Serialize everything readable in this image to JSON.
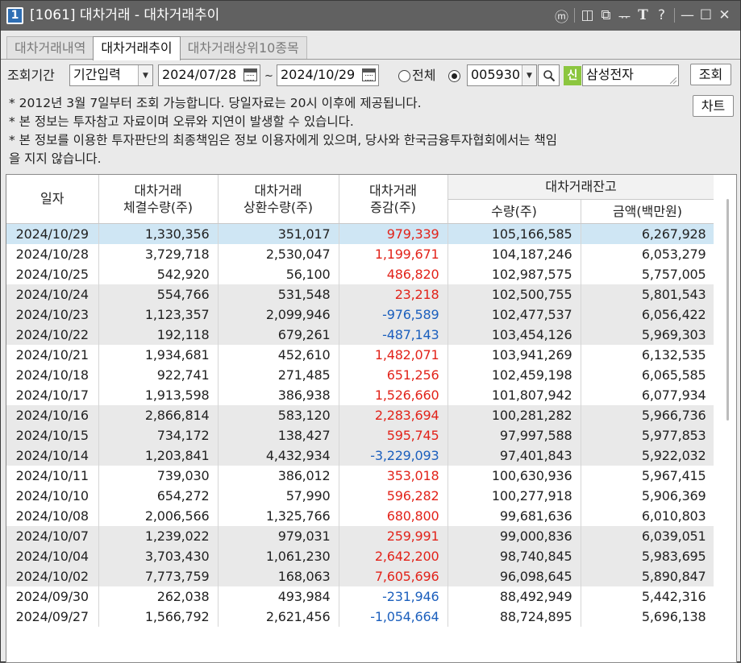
{
  "window": {
    "number": "1",
    "title": "[1061] 대차거래 - 대차거래추이"
  },
  "title_icons": [
    "memo-icon",
    "restore-icon",
    "copy-window-icon",
    "pin-icon",
    "font-icon",
    "help-icon",
    "minimize-icon",
    "maximize-icon",
    "close-icon"
  ],
  "title_icon_glyphs": [
    "ⓜ",
    "◫",
    "⧉",
    "ᅲ",
    "T",
    "?",
    "—",
    "☐",
    "✕"
  ],
  "tabs": [
    {
      "label": "대차거래내역",
      "active": false
    },
    {
      "label": "대차거래추이",
      "active": true
    },
    {
      "label": "대차거래상위10종목",
      "active": false
    }
  ],
  "query": {
    "period_label": "조회기간",
    "period_mode": "기간입력",
    "start_date": "2024/07/28",
    "tilde": "~",
    "end_date": "2024/10/29",
    "all_label": "전체",
    "stock_code": "005930",
    "badge": "신",
    "stock_name": "삼성전자",
    "search_button": "조회",
    "chart_button": "차트"
  },
  "notices": [
    "* 2012년 3월 7일부터 조회 가능합니다. 당일자료는 20시 이후에 제공됩니다.",
    "* 본 정보는 투자참고 자료이며 오류와 지연이 발생할 수 있습니다.",
    "* 본 정보를 이용한 투자판단의 최종책임은 정보 이용자에게 있으며, 당사와 한국금융투자협회에서는 책임",
    "   을 지지 않습니다."
  ],
  "table": {
    "headers": {
      "date": "일자",
      "executed": "대차거래\n체결수량(주)",
      "repaid": "대차거래\n상환수량(주)",
      "change": "대차거래\n증감(주)",
      "balance_group": "대차거래잔고",
      "balance_qty": "수량(주)",
      "balance_amt": "금액(백만원)"
    },
    "rows": [
      {
        "date": "2024/10/29",
        "executed": "1,330,356",
        "repaid": "351,017",
        "change": "979,339",
        "qty": "105,166,585",
        "amt": "6,267,928"
      },
      {
        "date": "2024/10/28",
        "executed": "3,729,718",
        "repaid": "2,530,047",
        "change": "1,199,671",
        "qty": "104,187,246",
        "amt": "6,053,279"
      },
      {
        "date": "2024/10/25",
        "executed": "542,920",
        "repaid": "56,100",
        "change": "486,820",
        "qty": "102,987,575",
        "amt": "5,757,005"
      },
      {
        "date": "2024/10/24",
        "executed": "554,766",
        "repaid": "531,548",
        "change": "23,218",
        "qty": "102,500,755",
        "amt": "5,801,543"
      },
      {
        "date": "2024/10/23",
        "executed": "1,123,357",
        "repaid": "2,099,946",
        "change": "-976,589",
        "qty": "102,477,537",
        "amt": "6,056,422"
      },
      {
        "date": "2024/10/22",
        "executed": "192,118",
        "repaid": "679,261",
        "change": "-487,143",
        "qty": "103,454,126",
        "amt": "5,969,303"
      },
      {
        "date": "2024/10/21",
        "executed": "1,934,681",
        "repaid": "452,610",
        "change": "1,482,071",
        "qty": "103,941,269",
        "amt": "6,132,535"
      },
      {
        "date": "2024/10/18",
        "executed": "922,741",
        "repaid": "271,485",
        "change": "651,256",
        "qty": "102,459,198",
        "amt": "6,065,585"
      },
      {
        "date": "2024/10/17",
        "executed": "1,913,598",
        "repaid": "386,938",
        "change": "1,526,660",
        "qty": "101,807,942",
        "amt": "6,077,934"
      },
      {
        "date": "2024/10/16",
        "executed": "2,866,814",
        "repaid": "583,120",
        "change": "2,283,694",
        "qty": "100,281,282",
        "amt": "5,966,736"
      },
      {
        "date": "2024/10/15",
        "executed": "734,172",
        "repaid": "138,427",
        "change": "595,745",
        "qty": "97,997,588",
        "amt": "5,977,853"
      },
      {
        "date": "2024/10/14",
        "executed": "1,203,841",
        "repaid": "4,432,934",
        "change": "-3,229,093",
        "qty": "97,401,843",
        "amt": "5,922,032"
      },
      {
        "date": "2024/10/11",
        "executed": "739,030",
        "repaid": "386,012",
        "change": "353,018",
        "qty": "100,630,936",
        "amt": "5,967,415"
      },
      {
        "date": "2024/10/10",
        "executed": "654,272",
        "repaid": "57,990",
        "change": "596,282",
        "qty": "100,277,918",
        "amt": "5,906,369"
      },
      {
        "date": "2024/10/08",
        "executed": "2,006,566",
        "repaid": "1,325,766",
        "change": "680,800",
        "qty": "99,681,636",
        "amt": "6,010,803"
      },
      {
        "date": "2024/10/07",
        "executed": "1,239,022",
        "repaid": "979,031",
        "change": "259,991",
        "qty": "99,000,836",
        "amt": "6,039,051"
      },
      {
        "date": "2024/10/04",
        "executed": "3,703,430",
        "repaid": "1,061,230",
        "change": "2,642,200",
        "qty": "98,740,845",
        "amt": "5,983,695"
      },
      {
        "date": "2024/10/02",
        "executed": "7,773,759",
        "repaid": "168,063",
        "change": "7,605,696",
        "qty": "96,098,645",
        "amt": "5,890,847"
      },
      {
        "date": "2024/09/30",
        "executed": "262,038",
        "repaid": "493,984",
        "change": "-231,946",
        "qty": "88,492,949",
        "amt": "5,442,316"
      },
      {
        "date": "2024/09/27",
        "executed": "1,566,792",
        "repaid": "2,621,456",
        "change": "-1,054,664",
        "qty": "88,724,895",
        "amt": "5,696,138"
      }
    ]
  },
  "colors": {
    "title_bar": "#616161",
    "positive": "#e2231a",
    "negative": "#1b5fbd",
    "selected_row": "#cfe6f4",
    "shaded_row": "#e9e9e9",
    "badge": "#8cc63f"
  }
}
